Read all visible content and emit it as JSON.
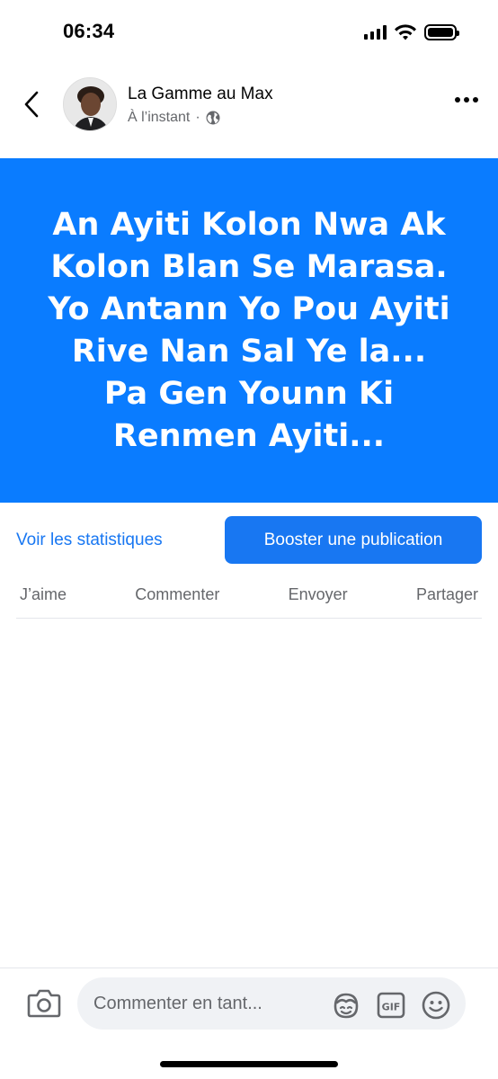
{
  "status_bar": {
    "time": "06:34"
  },
  "post": {
    "author": "La Gamme au Max",
    "timestamp": "À l’instant",
    "separator": "·",
    "privacy_icon": "globe-icon",
    "background_color": "#0a7cff",
    "text": "An Ayiti Kolon Nwa Ak Kolon Blan Se Marasa. Yo Antann Yo Pou Ayiti Rive Nan Sal Ye la... Pa Gen Younn Ki Renmen Ayiti..."
  },
  "tools": {
    "stats_label": "Voir les statistiques",
    "boost_label": "Booster une publication",
    "accent_color": "#1877f2"
  },
  "actions": {
    "like": "J’aime",
    "comment": "Commenter",
    "send": "Envoyer",
    "share": "Partager"
  },
  "comment_bar": {
    "placeholder": "Commenter en tant...",
    "icons": [
      "camera-icon",
      "avatar-sticker-icon",
      "gif-icon",
      "smiley-icon"
    ]
  }
}
